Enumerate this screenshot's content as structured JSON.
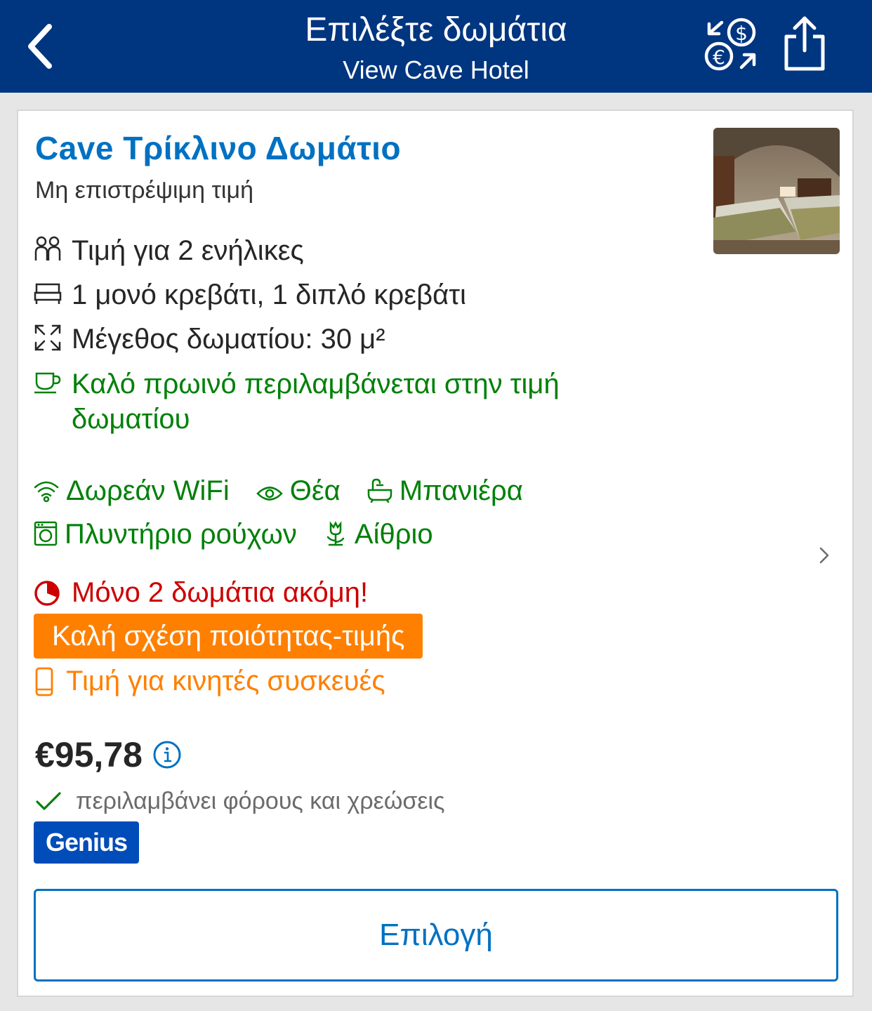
{
  "header": {
    "title": "Επιλέξτε δωμάτια",
    "subtitle": "View Cave Hotel",
    "bg_color": "#003580"
  },
  "room": {
    "name": "Cave Τρίκλινο Δωμάτιο",
    "refund_policy": "Μη επιστρέψιμη τιμή",
    "occupancy": "Τιμή για 2 ενήλικες",
    "beds": "1 μονό κρεβάτι, 1 διπλό κρεβάτι",
    "size": "Μέγεθος δωματίου: 30 μ²",
    "breakfast": "Καλό πρωινό περιλαμβάνεται στην τιμή δωματίου",
    "facilities": [
      {
        "icon": "wifi-icon",
        "label": "Δωρεάν WiFi"
      },
      {
        "icon": "eye-icon",
        "label": "Θέα"
      },
      {
        "icon": "bathtub-icon",
        "label": "Μπανιέρα"
      },
      {
        "icon": "washing-machine-icon",
        "label": "Πλυντήριο ρούχων"
      },
      {
        "icon": "flower-icon",
        "label": "Αίθριο"
      }
    ],
    "urgency": "Μόνο 2 δωμάτια ακόμη!",
    "value_badge": "Καλή σχέση ποιότητας-τιμής",
    "mobile_price": "Τιμή για κινητές συσκευές",
    "price": "€95,78",
    "taxes_note": "περιλαμβάνει φόρους και χρεώσεις",
    "genius_label": "Genius",
    "select_label": "Επιλογή"
  },
  "colors": {
    "link_blue": "#0071c2",
    "green": "#008009",
    "urgent_red": "#cc0000",
    "orange": "#ff8000",
    "genius_blue": "#004cb8"
  }
}
